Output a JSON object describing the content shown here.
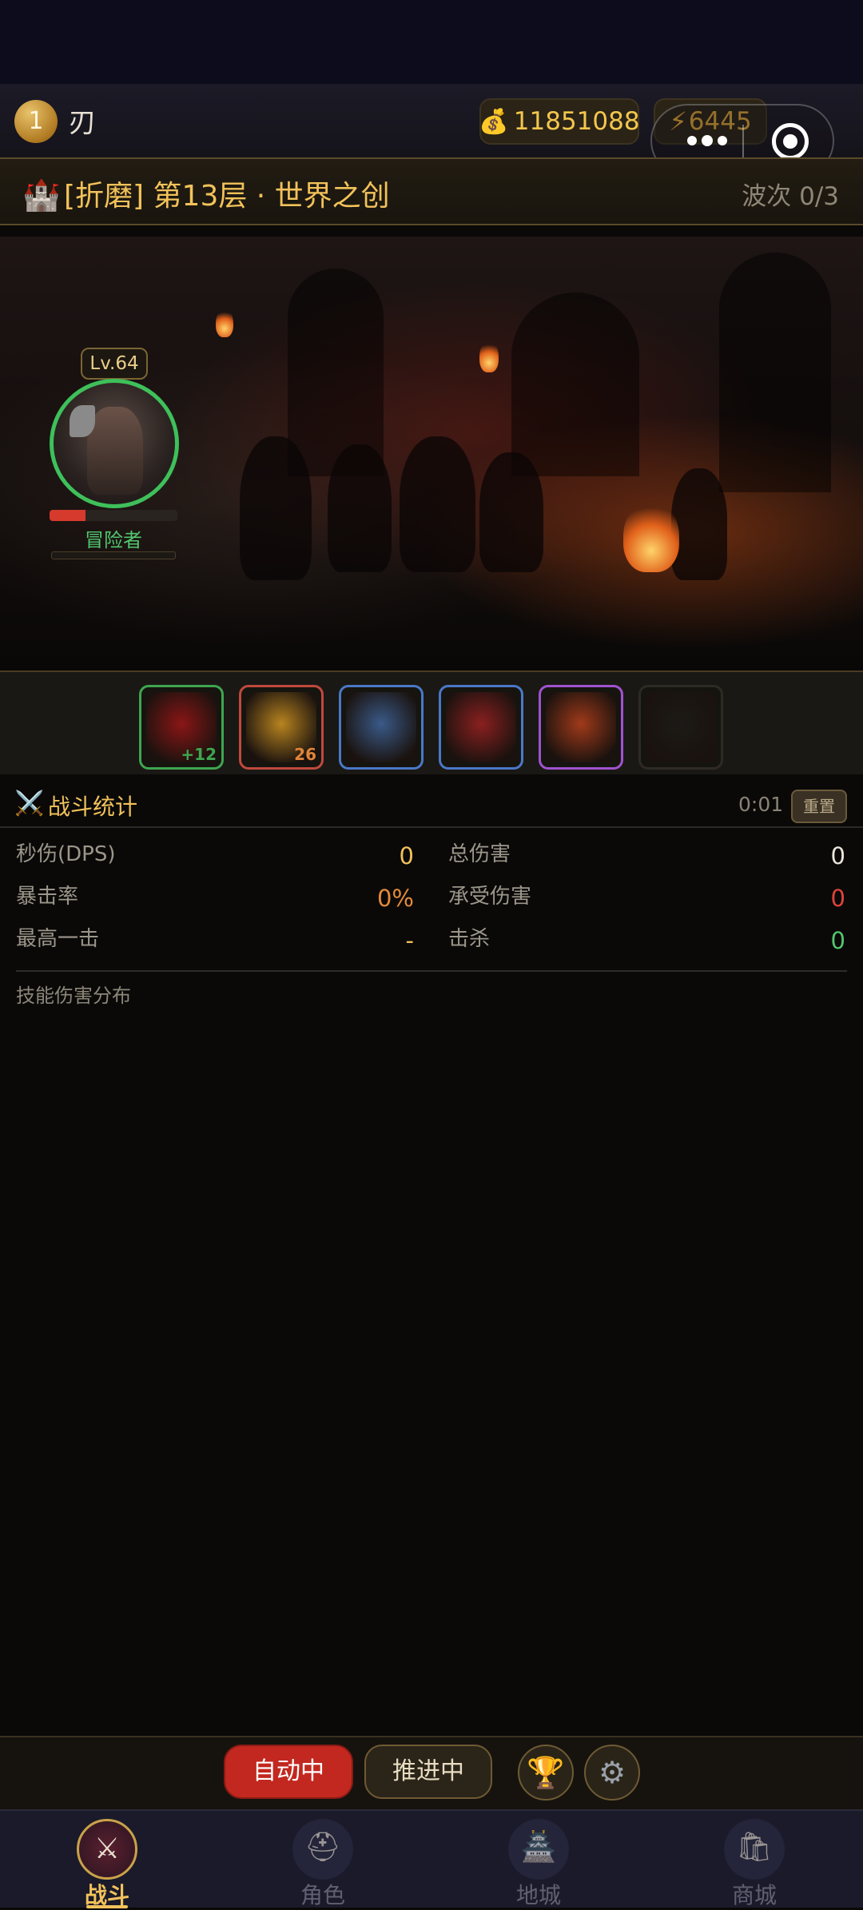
{
  "header": {
    "player_level": "1",
    "player_name": "刃",
    "gold": "11851088",
    "energy": "6445",
    "gold_icon": "money-bag-icon",
    "energy_icon": "lightning-icon"
  },
  "stage": {
    "title": "[折磨] 第13层 · 世界之创",
    "wave": "波次 0/3"
  },
  "hero": {
    "level": "Lv.64",
    "name": "冒险者",
    "hp_fraction": 0.28,
    "exp_fraction": 0.0
  },
  "skills": [
    {
      "name": "blood-slash-skill",
      "count": "+12",
      "border": "#3ea650",
      "art": "#8a1616"
    },
    {
      "name": "golden-burst-skill",
      "count": "26",
      "border": "#c0493c",
      "art": "#b88420"
    },
    {
      "name": "frost-shield-skill",
      "count": "",
      "border": "#4a78c8",
      "art": "#3a5a88"
    },
    {
      "name": "war-banner-skill",
      "count": "",
      "border": "#4a78c8",
      "art": "#8a2020"
    },
    {
      "name": "inferno-skill",
      "count": "",
      "border": "#a052d0",
      "art": "#a03a1a"
    },
    {
      "name": "empty-skill-slot",
      "count": "",
      "border": "#2e2a24",
      "art": "#1c1a16"
    }
  ],
  "stats": {
    "title": "战斗统计",
    "timer": "0:01",
    "reset_label": "重置",
    "dps_label": "秒伤(DPS)",
    "dps_value": "0",
    "total_damage_label": "总伤害",
    "total_damage_value": "0",
    "crit_rate_label": "暴击率",
    "crit_rate_value": "0%",
    "damage_taken_label": "承受伤害",
    "damage_taken_value": "0",
    "max_hit_label": "最高一击",
    "max_hit_value": "-",
    "kills_label": "击杀",
    "kills_value": "0",
    "distribution_label": "技能伤害分布"
  },
  "actions": {
    "auto_label": "自动中",
    "push_label": "推进中",
    "trophy_icon": "trophy-icon",
    "settings_icon": "gear-icon"
  },
  "nav": [
    {
      "label": "战斗",
      "icon": "crossed-swords-icon",
      "active": true
    },
    {
      "label": "角色",
      "icon": "knight-helmet-icon",
      "active": false
    },
    {
      "label": "地城",
      "icon": "castle-gate-icon",
      "active": false
    },
    {
      "label": "商城",
      "icon": "shop-bag-icon",
      "active": false
    }
  ],
  "colors": {
    "accent_gold": "#f2c25a",
    "hp_red": "#d53a2c",
    "kills_green": "#52c66e",
    "auto_red": "#c2281f"
  }
}
